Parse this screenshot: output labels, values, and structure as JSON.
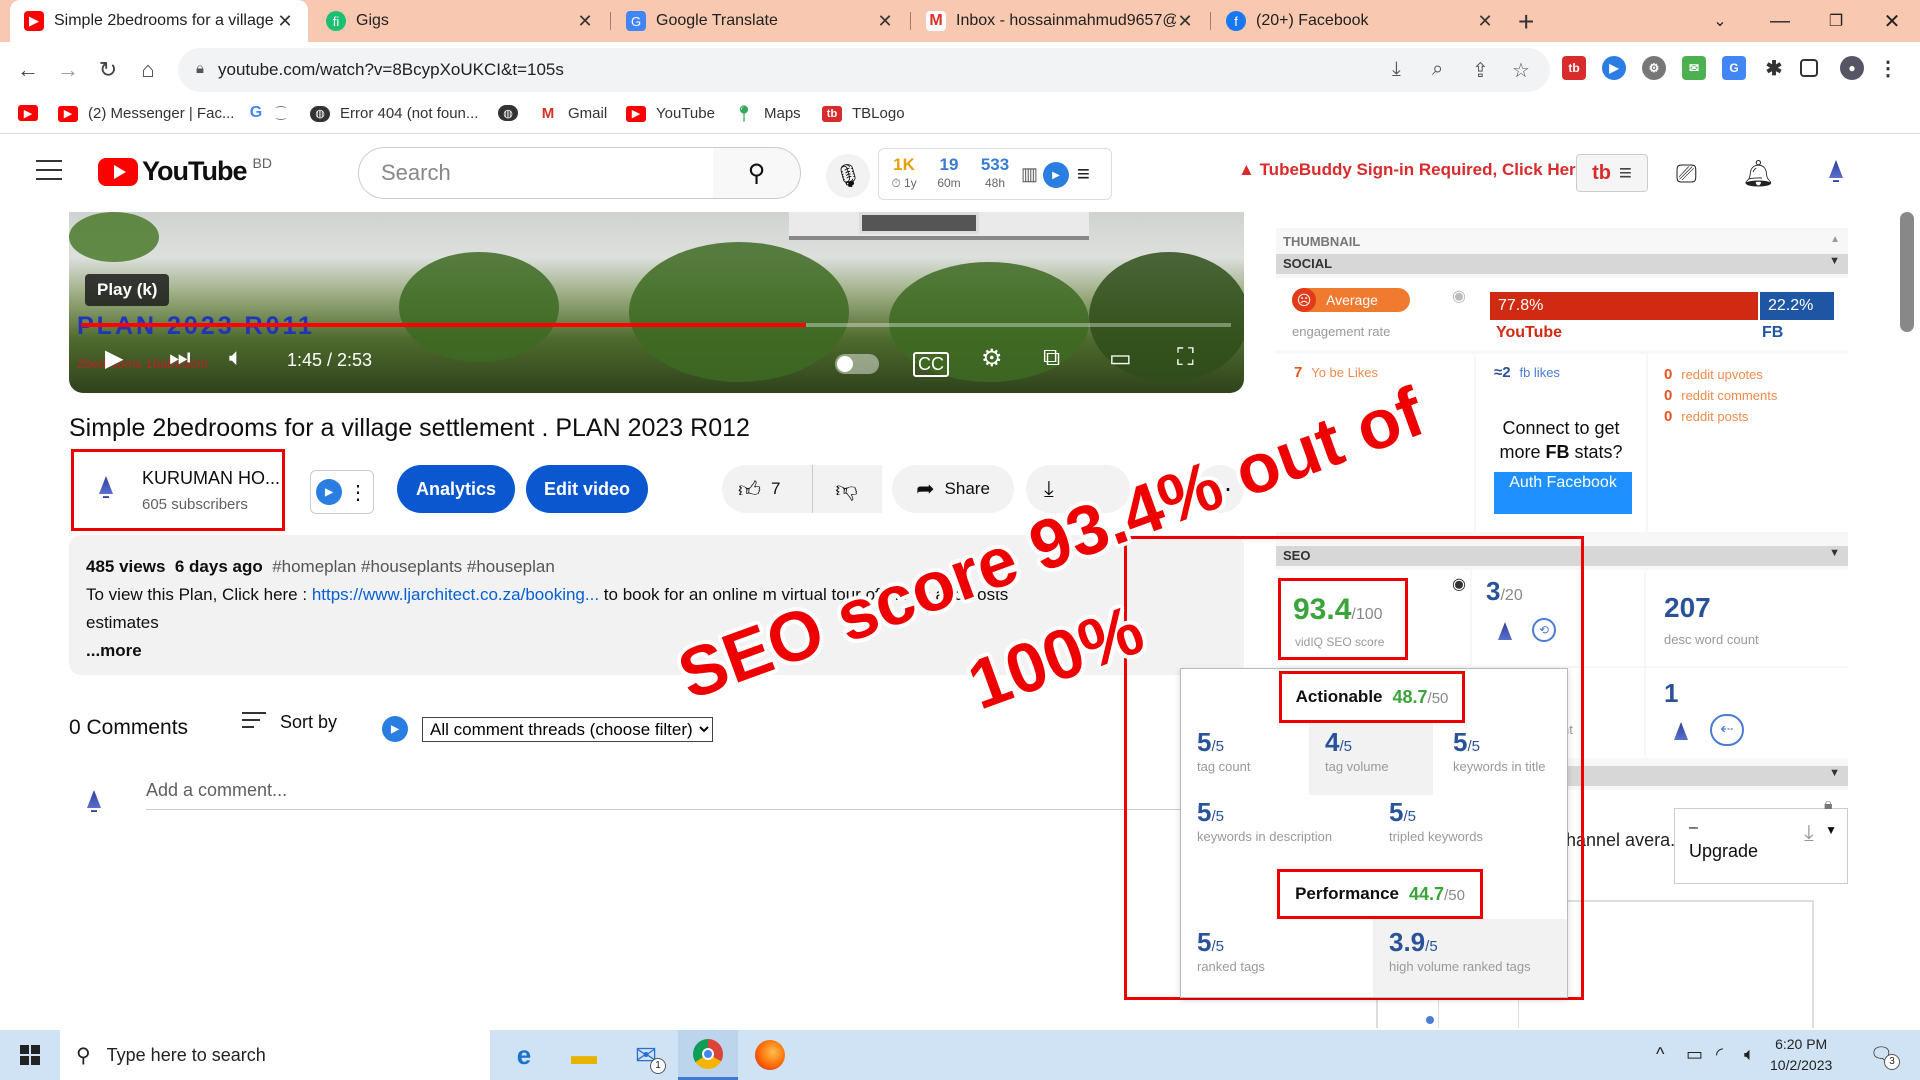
{
  "browser": {
    "tabs": [
      {
        "title": "Simple 2bedrooms for a village s",
        "icon": "youtube-icon",
        "active": true
      },
      {
        "title": "Gigs",
        "icon": "fiverr-icon",
        "active": false
      },
      {
        "title": "Google Translate",
        "icon": "translate-icon",
        "active": false
      },
      {
        "title": "Inbox - hossainmahmud9657@g",
        "icon": "gmail-icon",
        "active": false
      },
      {
        "title": "(20+) Facebook",
        "icon": "facebook-icon",
        "active": false
      }
    ],
    "url": "youtube.com/watch?v=8BcypXoUKCI&t=105s",
    "bookmarks": [
      {
        "label": "",
        "icon": "youtube-icon"
      },
      {
        "label": "(2) Messenger | Fac...",
        "icon": "youtube-icon"
      },
      {
        "label": "",
        "icon": "google-icon"
      },
      {
        "label": "Error 404 (not foun...",
        "icon": "globe-icon"
      },
      {
        "label": "",
        "icon": "globe-icon"
      },
      {
        "label": "Gmail",
        "icon": "gmail-icon"
      },
      {
        "label": "YouTube",
        "icon": "youtube-icon"
      },
      {
        "label": "Maps",
        "icon": "maps-icon"
      },
      {
        "label": "TBLogo",
        "icon": "tubebuddy-icon"
      }
    ]
  },
  "youtube": {
    "logo_text": "YouTube",
    "country": "BD",
    "search_placeholder": "Search",
    "vidiq_stats": [
      {
        "value": "1K",
        "label": "⏱ 1y"
      },
      {
        "value": "19",
        "label": "60m"
      },
      {
        "value": "533",
        "label": "48h"
      }
    ],
    "tubebuddy_warning": "TubeBuddy Sign-in Required, Click Here",
    "tubebuddy_logo": "tb"
  },
  "player": {
    "tooltip": "Play (k)",
    "overlay_title": "PLAN 2023 R011",
    "overlay_sub": "2bedrooms 1bathroom",
    "time": "1:45 / 2:53",
    "progress_percent": 63
  },
  "video": {
    "title": "Simple 2bedrooms for a village settlement . PLAN 2023 R012",
    "channel_name": "KURUMAN HO...",
    "subscribers": "605 subscribers",
    "analytics_label": "Analytics",
    "edit_label": "Edit video",
    "likes": "7",
    "share_label": "Share",
    "description": {
      "views": "485 views",
      "age": "6 days ago",
      "tags": "#homeplan #houseplants #houseplan",
      "line1_prefix": "To view this Plan, Click here : ",
      "link": "https://www.ljarchitect.co.za/booking...",
      "line1_suffix": "   to book for an online m",
      "line1_hidden": "virtual tour of the",
      "line1_end": "ds and costs",
      "line2": "estimates",
      "more": "...more"
    }
  },
  "comments": {
    "count": "0 Comments",
    "sort_label": "Sort by",
    "filter_value": "All comment threads (choose filter)",
    "add_placeholder": "Add a comment..."
  },
  "panel": {
    "thumbnail_head": "THUMBNAIL",
    "social_head": "SOCIAL",
    "engagement_badge": "Average",
    "engagement_label": "engagement rate",
    "yt_share": "77.8%",
    "fb_share": "22.2%",
    "yt_label": "YouTube",
    "fb_label": "FB",
    "yt_likes_num": "7",
    "yt_likes_label": "Yo   be Likes",
    "fb_likes_num": "≈2",
    "fb_likes_label": "fb likes",
    "reddit": [
      {
        "num": "0",
        "label": "reddit upvotes"
      },
      {
        "num": "0",
        "label": "reddit comments"
      },
      {
        "num": "0",
        "label": "reddit posts"
      }
    ],
    "connect_text_1": "Connect to get",
    "connect_text_2": "more ",
    "connect_bold": "FB",
    "connect_text_3": " stats?",
    "auth_label": "Auth Facebook",
    "seo_head": "SEO",
    "seo_score": "93.4",
    "seo_score_den": "/100",
    "seo_score_label": "vidIQ SEO score",
    "tag_score": "3",
    "tag_score_den": "/20",
    "desc_words": "207",
    "desc_words_label": "desc word count",
    "links_count": "1",
    "partial_label": "nt",
    "channel_avg": "hannel avera...",
    "upgrade": "Upgrade",
    "upgrade_dash": "–"
  },
  "seo_popup": {
    "actionable_label": "Actionable",
    "actionable_score": "48.7",
    "actionable_den": "/50",
    "actionable_stats": [
      {
        "value": "5",
        "den": "/5",
        "label": "tag count"
      },
      {
        "value": "4",
        "den": "/5",
        "label": "tag volume"
      },
      {
        "value": "5",
        "den": "/5",
        "label": "keywords in title"
      },
      {
        "value": "5",
        "den": "/5",
        "label": "keywords in description"
      },
      {
        "value": "5",
        "den": "/5",
        "label": "tripled keywords"
      }
    ],
    "performance_label": "Performance",
    "performance_score": "44.7",
    "performance_den": "/50",
    "performance_stats": [
      {
        "value": "5",
        "den": "/5",
        "label": "ranked tags"
      },
      {
        "value": "3.9",
        "den": "/5",
        "label": "high volume ranked tags"
      }
    ]
  },
  "annotation": {
    "line1": "SEO score 93.4% out of",
    "line2": "100%"
  },
  "taskbar": {
    "search_placeholder": "Type here to search",
    "time": "6:20 PM",
    "date": "10/2/2023",
    "mail_badge": "1",
    "notif_badge": "3"
  }
}
